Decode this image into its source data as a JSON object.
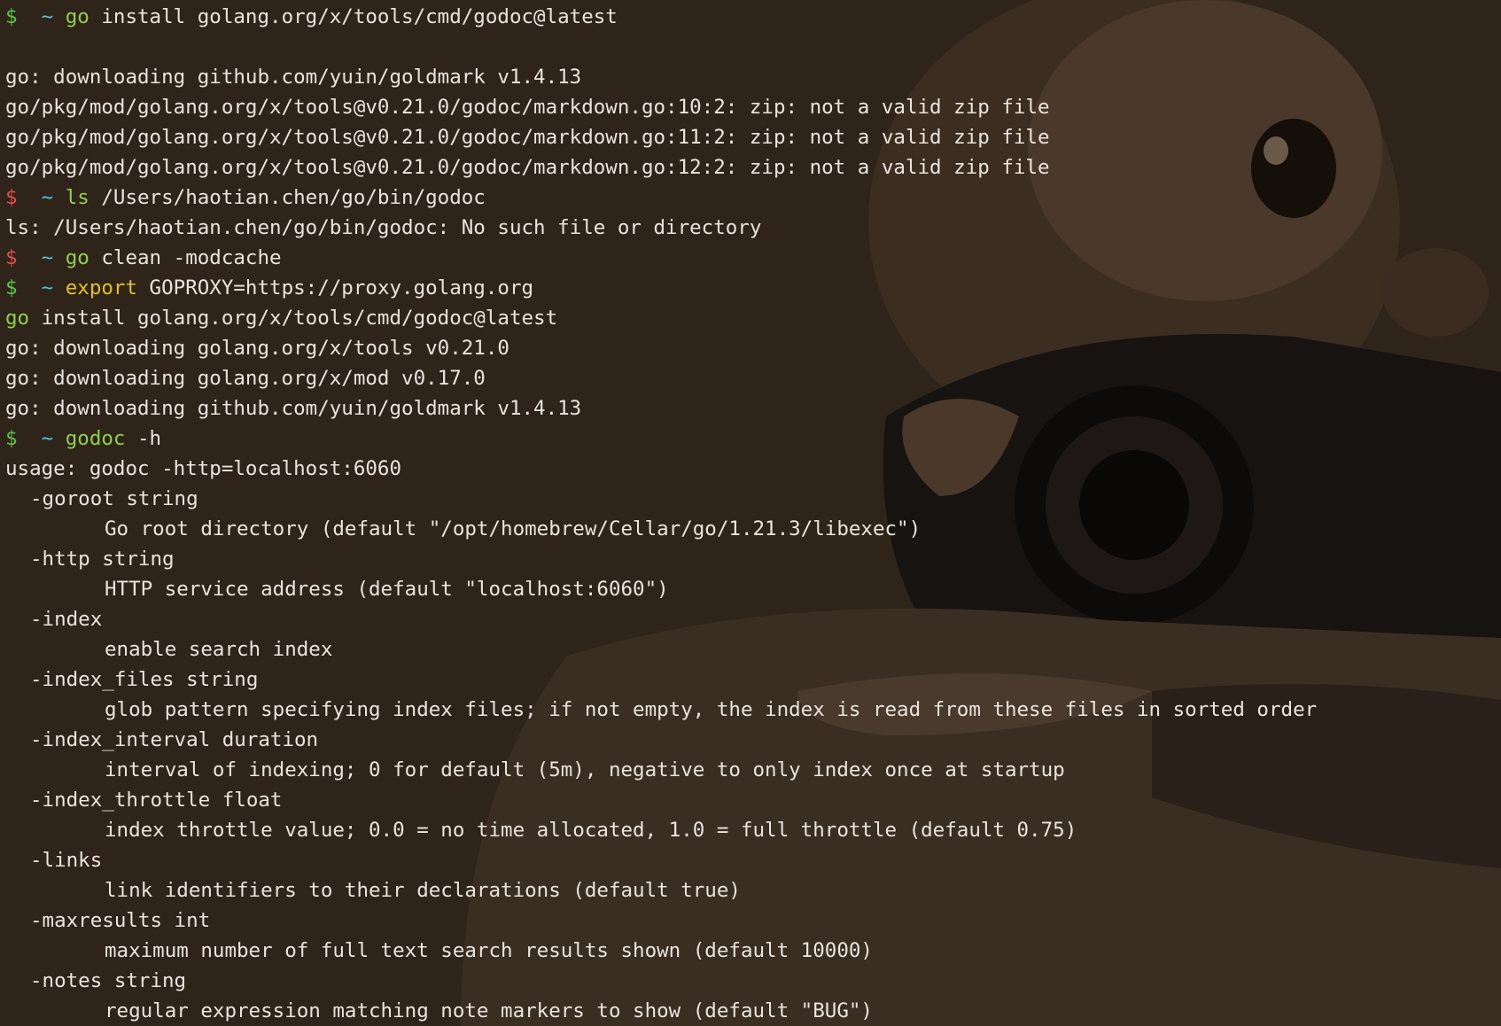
{
  "colors": {
    "background": "#2f241a",
    "text": "#e9e4dc",
    "prompt_error": "#e24c4c",
    "prompt_ok": "#57c64a",
    "tilde": "#4fc3d6",
    "command": "#8fd14a",
    "keyword": "#e3c11c"
  },
  "prompt": {
    "symbol": "$",
    "dir": "~"
  },
  "lines": [
    {
      "type": "prompt",
      "status": "ok",
      "cmd": "go",
      "args": " install golang.org/x/tools/cmd/godoc@latest"
    },
    {
      "type": "blank"
    },
    {
      "type": "out",
      "text": "go: downloading github.com/yuin/goldmark v1.4.13"
    },
    {
      "type": "out",
      "text": "go/pkg/mod/golang.org/x/tools@v0.21.0/godoc/markdown.go:10:2: zip: not a valid zip file"
    },
    {
      "type": "out",
      "text": "go/pkg/mod/golang.org/x/tools@v0.21.0/godoc/markdown.go:11:2: zip: not a valid zip file"
    },
    {
      "type": "out",
      "text": "go/pkg/mod/golang.org/x/tools@v0.21.0/godoc/markdown.go:12:2: zip: not a valid zip file"
    },
    {
      "type": "prompt",
      "status": "error",
      "cmd": "ls",
      "args": " /Users/haotian.chen/go/bin/godoc"
    },
    {
      "type": "out",
      "text": "ls: /Users/haotian.chen/go/bin/godoc: No such file or directory"
    },
    {
      "type": "prompt",
      "status": "error",
      "cmd": "go",
      "args": " clean -modcache"
    },
    {
      "type": "prompt",
      "status": "ok",
      "cmd": "export",
      "keyword": true,
      "args": " GOPROXY=https://proxy.golang.org"
    },
    {
      "type": "cont",
      "cmd": "go",
      "args": " install golang.org/x/tools/cmd/godoc@latest"
    },
    {
      "type": "out",
      "text": "go: downloading golang.org/x/tools v0.21.0"
    },
    {
      "type": "out",
      "text": "go: downloading golang.org/x/mod v0.17.0"
    },
    {
      "type": "out",
      "text": "go: downloading github.com/yuin/goldmark v1.4.13"
    },
    {
      "type": "prompt",
      "status": "ok",
      "cmd": "godoc",
      "args": " -h"
    },
    {
      "type": "out",
      "text": "usage: godoc -http=localhost:6060"
    },
    {
      "type": "flag",
      "text": "-goroot string"
    },
    {
      "type": "desc",
      "text": "Go root directory (default \"/opt/homebrew/Cellar/go/1.21.3/libexec\")"
    },
    {
      "type": "flag",
      "text": "-http string"
    },
    {
      "type": "desc",
      "text": "HTTP service address (default \"localhost:6060\")"
    },
    {
      "type": "flag",
      "text": "-index"
    },
    {
      "type": "desc",
      "text": "enable search index"
    },
    {
      "type": "flag",
      "text": "-index_files string"
    },
    {
      "type": "desc",
      "text": "glob pattern specifying index files; if not empty, the index is read from these files in sorted order"
    },
    {
      "type": "flag",
      "text": "-index_interval duration"
    },
    {
      "type": "desc",
      "text": "interval of indexing; 0 for default (5m), negative to only index once at startup"
    },
    {
      "type": "flag",
      "text": "-index_throttle float"
    },
    {
      "type": "desc",
      "text": "index throttle value; 0.0 = no time allocated, 1.0 = full throttle (default 0.75)"
    },
    {
      "type": "flag",
      "text": "-links"
    },
    {
      "type": "desc",
      "text": "link identifiers to their declarations (default true)"
    },
    {
      "type": "flag",
      "text": "-maxresults int"
    },
    {
      "type": "desc",
      "text": "maximum number of full text search results shown (default 10000)"
    },
    {
      "type": "flag",
      "text": "-notes string"
    },
    {
      "type": "desc",
      "text": "regular expression matching note markers to show (default \"BUG\")"
    }
  ]
}
